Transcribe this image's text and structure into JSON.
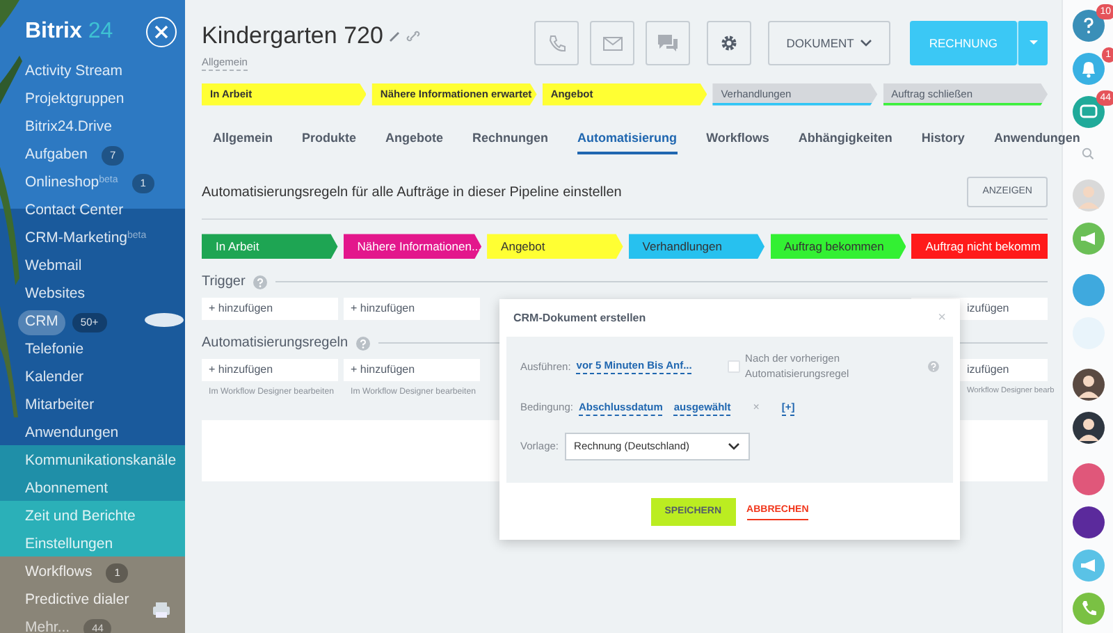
{
  "sidebar": {
    "logo": {
      "brand": "Bitrix",
      "number": "24"
    },
    "items": [
      {
        "label": "Activity Stream",
        "selected": false
      },
      {
        "label": "Projektgruppen",
        "selected": false
      },
      {
        "label": "Bitrix24.Drive",
        "selected": false
      },
      {
        "label": "Aufgaben",
        "badge": "7",
        "selected": false
      },
      {
        "label": "Onlineshop",
        "sup": "beta",
        "badge": "1",
        "selected": false
      },
      {
        "label": "Contact Center",
        "selected": false
      },
      {
        "label": "CRM-Marketing",
        "sup": "beta",
        "selected": false
      },
      {
        "label": "Webmail",
        "selected": false
      },
      {
        "label": "Websites",
        "selected": false
      },
      {
        "label": "CRM",
        "badge": "50+",
        "selected": true
      },
      {
        "label": "Telefonie",
        "selected": false
      },
      {
        "label": "Kalender",
        "selected": false
      },
      {
        "label": "Mitarbeiter",
        "selected": false
      },
      {
        "label": "Anwendungen",
        "selected": false
      },
      {
        "label": "Kommunikationskanäle",
        "selected": false
      },
      {
        "label": "Abonnement",
        "selected": false
      },
      {
        "label": "Zeit und Berichte",
        "selected": false
      },
      {
        "label": "Einstellungen",
        "selected": false
      },
      {
        "label": "Workflows",
        "badge": "1",
        "selected": false
      },
      {
        "label": "Predictive dialer",
        "selected": false
      }
    ],
    "more": {
      "label": "Mehr...",
      "badge": "44"
    }
  },
  "header": {
    "title": "Kindergarten 720",
    "category": "Allgemein",
    "document_button": "DOKUMENT",
    "invoice_button": "RECHNUNG"
  },
  "progress": [
    {
      "label": "In Arbeit",
      "passed": true
    },
    {
      "label": "Nähere Informationen erwartet",
      "passed": true
    },
    {
      "label": "Angebot",
      "passed": true
    },
    {
      "label": "Verhandlungen",
      "passed": false,
      "color": "#2fc6f6"
    },
    {
      "label": "Auftrag schließen",
      "passed": false,
      "color": "#3bf03b"
    }
  ],
  "tabs": [
    {
      "label": "Allgemein",
      "selected": false
    },
    {
      "label": "Produkte",
      "selected": false
    },
    {
      "label": "Angebote",
      "selected": false
    },
    {
      "label": "Rechnungen",
      "selected": false
    },
    {
      "label": "Automatisierung",
      "selected": true
    },
    {
      "label": "Workflows",
      "selected": false
    },
    {
      "label": "Abhängigkeiten",
      "selected": false
    },
    {
      "label": "History",
      "selected": false
    },
    {
      "label": "Anwendungen",
      "selected": false
    }
  ],
  "automation": {
    "heading": "Automatisierungsregeln für alle Aufträge in dieser Pipeline einstellen",
    "show_button": "ANZEIGEN",
    "stages": [
      {
        "label": "In Arbeit",
        "color": "#1ea553"
      },
      {
        "label": "Nähere Informationen...",
        "color": "#e3178c"
      },
      {
        "label": "Angebot",
        "color": "#ffff33"
      },
      {
        "label": "Verhandlungen",
        "color": "#27c1ef"
      },
      {
        "label": "Auftrag bekommen",
        "color": "#33f033"
      },
      {
        "label": "Auftrag nicht bekomm",
        "color": "#ff1a1a"
      }
    ],
    "trigger_title": "Trigger",
    "rules_title": "Automatisierungsregeln",
    "columns": [
      {
        "trigger_add": "+ hinzufügen",
        "rule_add": "+ hinzufügen",
        "designer_link": "Im Workflow Designer bearbeiten"
      },
      {
        "trigger_add": "+ hinzufügen",
        "rule_add": "+ hinzufügen",
        "designer_link": "Im Workflow Designer bearbeiten"
      },
      {},
      {},
      {},
      {
        "trigger_add": "izufügen",
        "rule_add": "izufügen",
        "designer_link": "Workflow Designer bearb"
      }
    ]
  },
  "dialog": {
    "title": "CRM-Dokument erstellen",
    "close": "×",
    "run_label": "Ausführen:",
    "run_value": "vor 5 Minuten Bis Anf...",
    "after_previous": {
      "label": "Nach der vorherigen Automatisierungsregel",
      "checked": false
    },
    "condition_label": "Bedingung:",
    "condition_field": "Abschlussdatum",
    "condition_value": "ausgewählt",
    "condition_remove": "×",
    "condition_add": "[+]",
    "template_label": "Vorlage:",
    "template_value": "Rechnung (Deutschland)",
    "save_button": "SPEICHERN",
    "cancel_button": "ABBRECHEN"
  },
  "right_bar": {
    "help_badge": "10",
    "notifications_badge": "1",
    "chats_badge": "44"
  }
}
